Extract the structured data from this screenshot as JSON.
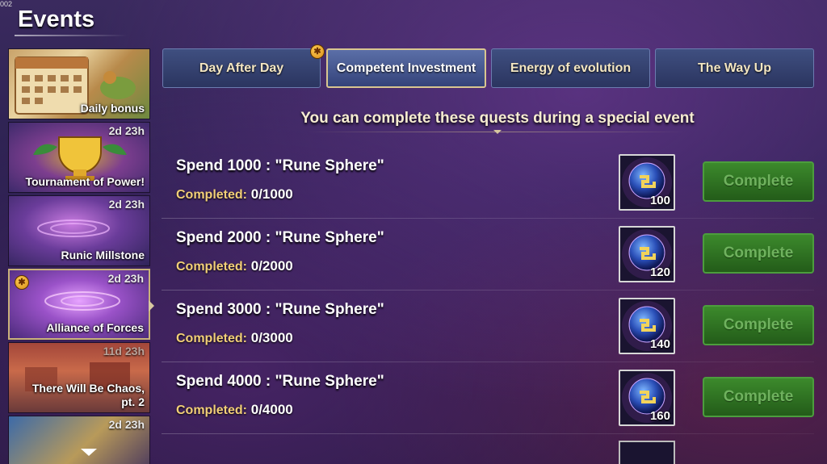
{
  "build_tag": "002",
  "header": {
    "title": "Events"
  },
  "sidebar": {
    "items": [
      {
        "label": "Daily bonus",
        "timer": ""
      },
      {
        "label": "Tournament of Power!",
        "timer": "2d 23h"
      },
      {
        "label": "Runic Millstone",
        "timer": "2d 23h"
      },
      {
        "label": "Alliance of Forces",
        "timer": "2d 23h"
      },
      {
        "label": "There Will Be Chaos, pt. 2",
        "timer": "11d 23h"
      },
      {
        "label": "",
        "timer": "2d 23h"
      }
    ]
  },
  "tabs": [
    {
      "label": "Day After Day",
      "selected": false
    },
    {
      "label": "Competent Investment",
      "selected": true
    },
    {
      "label": "Energy of evolution",
      "selected": false
    },
    {
      "label": "The Way Up",
      "selected": false
    }
  ],
  "main": {
    "subtitle": "You can complete these quests during a special event",
    "progress_label": "Completed:",
    "complete_label": "Complete",
    "quests": [
      {
        "title": "Spend 1000 : \"Rune Sphere\"",
        "progress": "0/1000",
        "reward_count": "100"
      },
      {
        "title": "Spend 2000 : \"Rune Sphere\"",
        "progress": "0/2000",
        "reward_count": "120"
      },
      {
        "title": "Spend 3000 : \"Rune Sphere\"",
        "progress": "0/3000",
        "reward_count": "140"
      },
      {
        "title": "Spend 4000 : \"Rune Sphere\"",
        "progress": "0/4000",
        "reward_count": "160"
      }
    ]
  },
  "colors": {
    "accent_gold": "#c9b27a",
    "button_green": "#3c8a2c",
    "progress_label": "#f2cf78",
    "tab_blue": "#3f4f80"
  },
  "icons": {
    "reward": "rune-sphere-icon",
    "badge": "gift-icon",
    "scroll": "chevron-down-icon"
  }
}
